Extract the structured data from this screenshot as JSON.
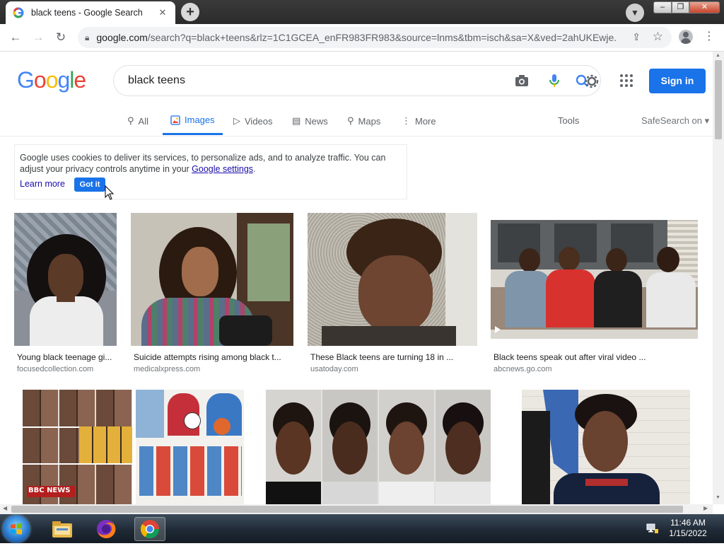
{
  "browser": {
    "tab_title": "black teens - Google Search",
    "tab_close": "✕",
    "new_tab": "+",
    "url_host": "google.com",
    "url_rest": "/search?q=black+teens&rlz=1C1GCEA_enFR983FR983&source=lnms&tbm=isch&sa=X&ved=2ahUKEwje...",
    "win_min": "–",
    "win_max": "❐",
    "win_close": "✕"
  },
  "header": {
    "logo_letters": [
      "G",
      "o",
      "o",
      "g",
      "l",
      "e"
    ],
    "logo_colors": [
      "#4285F4",
      "#EA4335",
      "#FBBC05",
      "#4285F4",
      "#34A853",
      "#EA4335"
    ],
    "query": "black teens",
    "signin_label": "Sign in"
  },
  "search_tabs": [
    {
      "label": "All",
      "icon": "search-icon"
    },
    {
      "label": "Images",
      "icon": "image-icon",
      "active": true
    },
    {
      "label": "Videos",
      "icon": "video-icon"
    },
    {
      "label": "News",
      "icon": "news-icon"
    },
    {
      "label": "Maps",
      "icon": "map-pin-icon"
    },
    {
      "label": "More",
      "icon": "kebab-icon"
    }
  ],
  "tools_label": "Tools",
  "safesearch_label": "SafeSearch on ▾",
  "cookie_banner": {
    "text_before": "Google uses cookies to deliver its services, to personalize ads, and to analyze traffic. You can adjust your privacy controls anytime in your ",
    "link": "Google settings",
    "text_after": ".",
    "learn_more": "Learn more",
    "got_it": "Got it"
  },
  "results": [
    {
      "caption": "Young black teenage gi...",
      "source": "focusedcollection.com"
    },
    {
      "caption": "Suicide attempts rising among black t...",
      "source": "medicalxpress.com"
    },
    {
      "caption": "These Black teens are turning 18 in ...",
      "source": "usatoday.com"
    },
    {
      "caption": "Black teens speak out after viral video ...",
      "source": "abcnews.go.com"
    },
    {
      "caption": "",
      "source": "",
      "badge": "BBC NEWS"
    },
    {
      "caption": "",
      "source": ""
    },
    {
      "caption": "",
      "source": ""
    }
  ],
  "taskbar": {
    "time": "11:46 AM",
    "date": "1/15/2022"
  }
}
